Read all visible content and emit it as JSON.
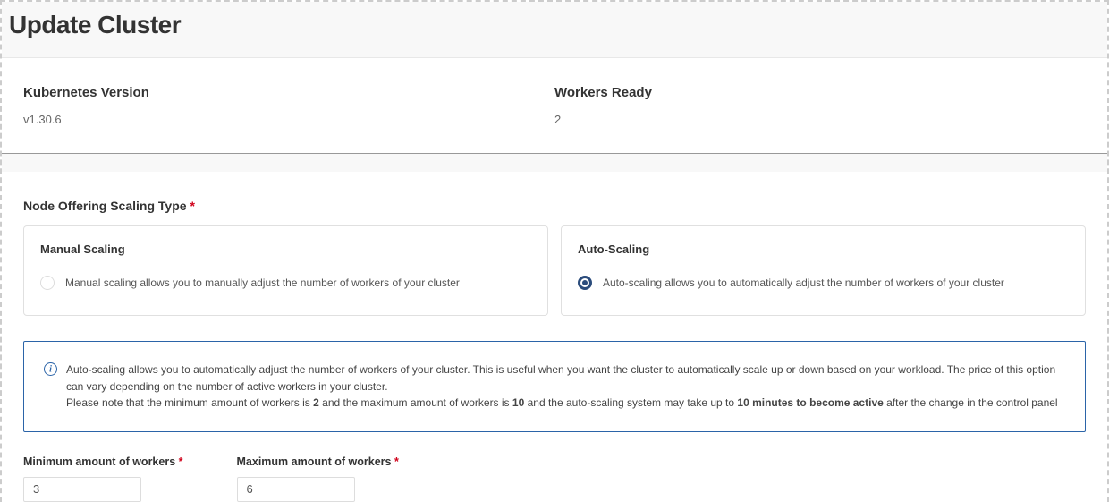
{
  "header": {
    "title": "Update Cluster"
  },
  "info": {
    "kubernetes_version_label": "Kubernetes Version",
    "kubernetes_version_value": "v1.30.6",
    "workers_ready_label": "Workers Ready",
    "workers_ready_value": "2"
  },
  "scaling": {
    "section_label": "Node Offering Scaling Type",
    "manual": {
      "title": "Manual Scaling",
      "desc": "Manual scaling allows you to manually adjust the number of workers of your cluster"
    },
    "auto": {
      "title": "Auto-Scaling",
      "desc": "Auto-scaling allows you to automatically adjust the number of workers of your cluster"
    }
  },
  "info_box": {
    "line1_pre": "Auto-scaling allows you to automatically adjust the number of workers of your cluster. This is useful when you want the cluster to automatically scale up or down based on your workload. The price of this option can vary depending on the number of active workers in your cluster.",
    "line2_a": "Please note that the minimum amount of workers is ",
    "line2_min": "2",
    "line2_b": " and the maximum amount of workers is ",
    "line2_max": "10",
    "line2_c": " and the auto-scaling system may take up to ",
    "line2_time": "10 minutes to become active",
    "line2_d": " after the change in the control panel"
  },
  "amounts": {
    "min_label": "Minimum amount of workers",
    "min_value": "3",
    "max_label": "Maximum amount of workers",
    "max_value": "6"
  }
}
